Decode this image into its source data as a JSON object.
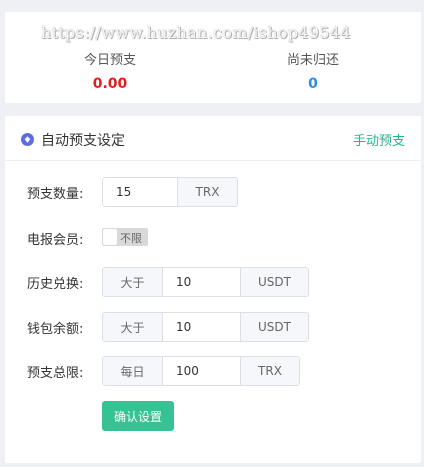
{
  "watermark": "https://www.huzhan.com/ishop49544",
  "stats": {
    "today_label": "今日预支",
    "today_value": "0.00",
    "unreturned_label": "尚未归还",
    "unreturned_value": "0"
  },
  "settings": {
    "title": "自动预支设定",
    "manual_link": "手动预支",
    "amount": {
      "label": "预支数量:",
      "value": "15",
      "unit": "TRX"
    },
    "telegram_member": {
      "label": "电报会员:",
      "toggle_text": "不限",
      "enabled": false
    },
    "history_exchange": {
      "label": "历史兑换:",
      "prefix": "大于",
      "value": "10",
      "unit": "USDT"
    },
    "wallet_balance": {
      "label": "钱包余额:",
      "prefix": "大于",
      "value": "10",
      "unit": "USDT"
    },
    "total_limit": {
      "label": "预支总限:",
      "prefix": "每日",
      "value": "100",
      "unit": "TRX"
    },
    "confirm_button": "确认设置"
  },
  "colors": {
    "accent": "#36c293",
    "link": "#25b78e",
    "negative": "#e02020",
    "info": "#2d8cf0",
    "icon": "#5b6ee1"
  }
}
